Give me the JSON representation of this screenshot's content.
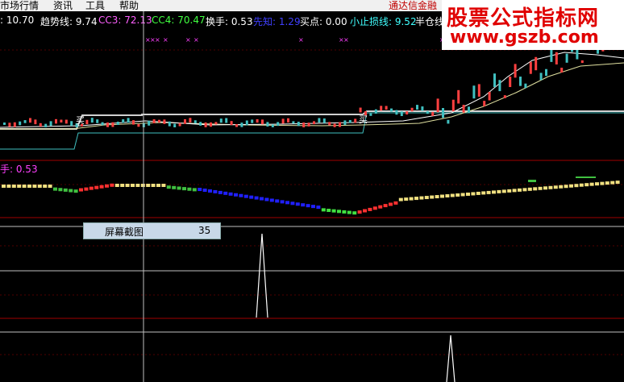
{
  "menu": {
    "items": [
      "市场行情",
      "资讯",
      "工具",
      "帮助"
    ],
    "right_text": "通达信金融"
  },
  "watermark": {
    "line1": "股票公式指标网",
    "line2": "www.gszb.com"
  },
  "indicators": [
    {
      "label": ": 10.70",
      "color": "#ffffff"
    },
    {
      "label": "趋势线: 9.74",
      "color": "#ffffff"
    },
    {
      "label": "CC3: 72.13",
      "color": "#ff60ff"
    },
    {
      "label": "CC4: 70.47",
      "color": "#40ff40"
    },
    {
      "label": "换手: 0.53",
      "color": "#ffffff"
    },
    {
      "label": "先知: 1.29",
      "color": "#4040ff"
    },
    {
      "label": "买点: 0.00",
      "color": "#ffffff"
    },
    {
      "label": "小止损线: 9.52",
      "color": "#40ffff"
    },
    {
      "label": "半仓线",
      "color": "#ffffff"
    }
  ],
  "sub_panel_label": "手: 0.53",
  "tooltip": {
    "label": "屏幕截图",
    "value": "35"
  },
  "chart_markers": {
    "buy_label": "买"
  },
  "colors": {
    "background": "#000000",
    "panel_border": "#a00000",
    "up_candle": "#ff4040",
    "down_candle": "#40c0c0",
    "spike": "#ffffff"
  }
}
